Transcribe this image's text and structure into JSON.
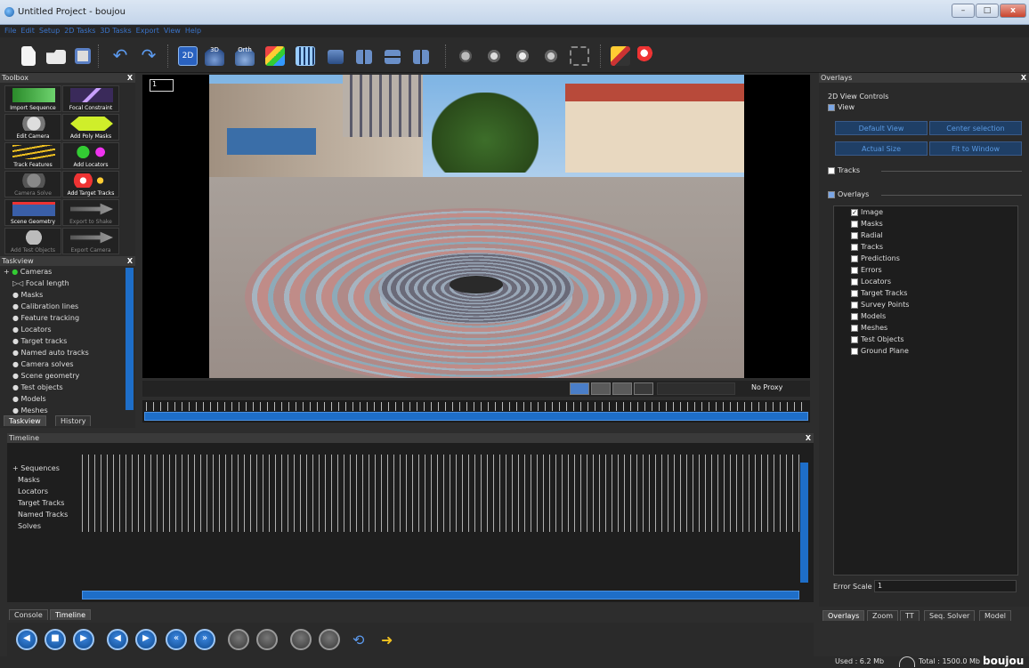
{
  "window": {
    "title": "Untitled Project - boujou",
    "minimize": "–",
    "maximize": "□",
    "close": "x"
  },
  "menu": [
    "File",
    "Edit",
    "Setup",
    "2D Tasks",
    "3D Tasks",
    "Export",
    "View",
    "Help"
  ],
  "toolbar_icons": [
    "new-file-icon",
    "open-folder-icon",
    "save-icon",
    "undo-icon",
    "redo-icon",
    "2d-view-icon",
    "3d-view-icon",
    "orthographic-view-icon",
    "multi-view-icon",
    "grid-view-icon",
    "layout-1-icon",
    "layout-2-icon",
    "layout-3-icon",
    "layout-4-icon",
    "camera-wizard-icon",
    "solver-icon",
    "eye-icon",
    "focus-icon",
    "frame-select-icon",
    "magic-icon",
    "search-icon"
  ],
  "toolbar_labels": {
    "view2d": "2D",
    "view3d": "3D",
    "ortho": "Orth"
  },
  "toolbox": {
    "title": "Toolbox",
    "close": "X",
    "tools": [
      {
        "label": "Import Sequence",
        "enabled": true
      },
      {
        "label": "Focal Constraint",
        "enabled": true
      },
      {
        "label": "Edit Camera",
        "enabled": true
      },
      {
        "label": "Add Poly Masks",
        "enabled": true
      },
      {
        "label": "Track Features",
        "enabled": true
      },
      {
        "label": "Add Locators",
        "enabled": true
      },
      {
        "label": "Camera Solve",
        "enabled": false
      },
      {
        "label": "Add Target Tracks",
        "enabled": true
      },
      {
        "label": "Scene Geometry",
        "enabled": true
      },
      {
        "label": "Export to Shake",
        "enabled": false
      },
      {
        "label": "Add Test Objects",
        "enabled": false
      },
      {
        "label": "Export Camera",
        "enabled": false
      }
    ]
  },
  "taskview": {
    "title": "Taskview",
    "close": "X",
    "items": [
      "Cameras",
      "Focal length",
      "Masks",
      "Calibration lines",
      "Feature tracking",
      "Locators",
      "Target tracks",
      "Named auto tracks",
      "Camera solves",
      "Scene geometry",
      "Test objects",
      "Models",
      "Meshes"
    ],
    "tabs": [
      "Taskview",
      "History"
    ]
  },
  "viewport": {
    "frame": "1",
    "proxy": "No Proxy",
    "view_icon_names": [
      "eye-icon",
      "film-icon",
      "undo-view-icon",
      "grid-icon"
    ]
  },
  "timeline": {
    "title": "Timeline",
    "close": "X",
    "items": [
      "Sequences",
      "Masks",
      "Locators",
      "Target Tracks",
      "Named Tracks",
      "Solves"
    ],
    "tabs": [
      "Console",
      "Timeline"
    ]
  },
  "transport_icons": [
    "go-start-icon",
    "stop-icon",
    "play-icon",
    "step-back-icon",
    "step-forward-icon",
    "rewind-icon",
    "fast-forward-icon",
    "key-back-icon",
    "key-forward-icon",
    "prev-key-icon",
    "next-key-icon",
    "loop-icon",
    "export-icon"
  ],
  "overlays": {
    "title": "Overlays",
    "close": "X",
    "section_title": "2D View Controls",
    "view_label": "View",
    "buttons": [
      "Default View",
      "Center selection",
      "Actual Size",
      "Fit to Window"
    ],
    "tracks_label": "Tracks",
    "overlays_label": "Overlays",
    "items": [
      {
        "label": "Image",
        "checked": true
      },
      {
        "label": "Masks",
        "checked": false
      },
      {
        "label": "Radial",
        "checked": false
      },
      {
        "label": "Tracks",
        "checked": false
      },
      {
        "label": "Predictions",
        "checked": false
      },
      {
        "label": "Errors",
        "checked": false
      },
      {
        "label": "Locators",
        "checked": false
      },
      {
        "label": "Target Tracks",
        "checked": false
      },
      {
        "label": "Survey Points",
        "checked": false
      },
      {
        "label": "Models",
        "checked": false
      },
      {
        "label": "Meshes",
        "checked": false
      },
      {
        "label": "Test Objects",
        "checked": false
      },
      {
        "label": "Ground Plane",
        "checked": false
      }
    ],
    "error_scale_label": "Error Scale",
    "error_scale_value": "1",
    "tabs": [
      "Overlays",
      "Zoom",
      "TT",
      "Seq. Solver",
      "Model"
    ]
  },
  "status": {
    "used": "Used : 6.2 Mb",
    "total": "Total : 1500.0 Mb",
    "brand": "boujou"
  },
  "colors": {
    "accent_blue": "#1e6ec8",
    "menu_text": "#3a73c8"
  }
}
